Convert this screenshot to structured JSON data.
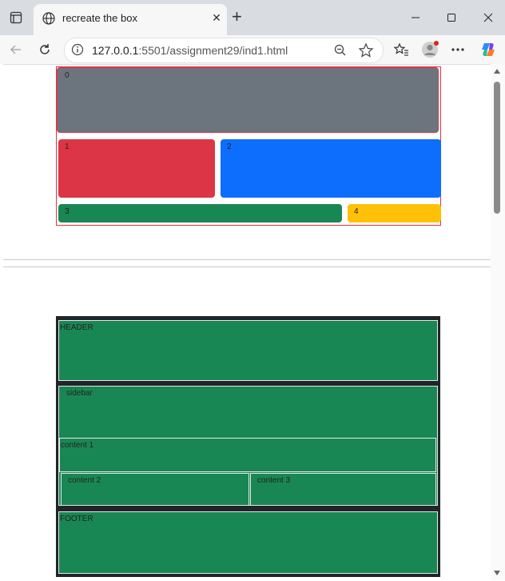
{
  "browser": {
    "tab_title": "recreate the box",
    "url_host": "127.0.0.1",
    "url_path": ":5501/assignment29/ind1.html"
  },
  "boxes": {
    "b0": "0",
    "b1": "1",
    "b2": "2",
    "b3": "3",
    "b4": "4"
  },
  "layout": {
    "header": "HEADER",
    "sidebar": "sidebar",
    "content1": "content 1",
    "content2": "content 2",
    "content3": "content 3",
    "footer": "FOOTER"
  },
  "colors": {
    "gray": "#6c757d",
    "red": "#dc3545",
    "blue": "#0d6efd",
    "green": "#198754",
    "yellow": "#ffc107",
    "dark": "#212529"
  }
}
